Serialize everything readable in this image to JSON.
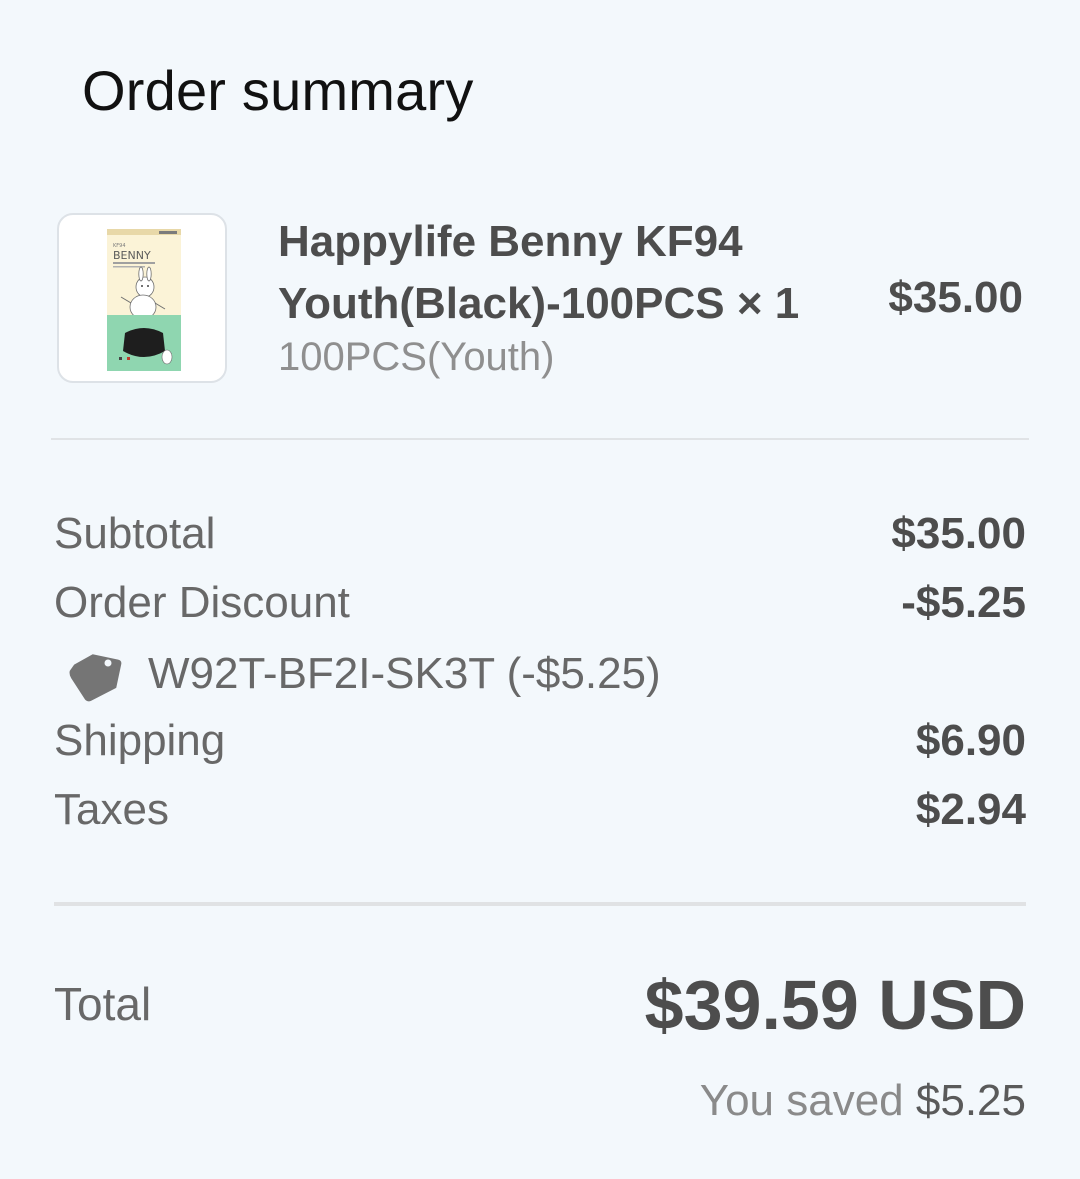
{
  "header": {
    "title": "Order summary"
  },
  "product": {
    "image_text": "BENNY",
    "name_line1": "Happylife Benny KF94",
    "name_line2": "Youth(Black)-100PCS × 1",
    "variant": "100PCS(Youth)",
    "price": "$35.00"
  },
  "summary": {
    "subtotal_label": "Subtotal",
    "subtotal_value": "$35.00",
    "discount_label": "Order Discount",
    "discount_value": "-$5.25",
    "discount_code": "W92T-BF2I-SK3T (-$5.25)",
    "shipping_label": "Shipping",
    "shipping_value": "$6.90",
    "taxes_label": "Taxes",
    "taxes_value": "$2.94"
  },
  "total": {
    "label": "Total",
    "value": "$39.59 USD",
    "saved_prefix": "You saved",
    "saved_amount": "$5.25"
  },
  "colors": {
    "background": "#f3f8fc",
    "text_dark": "#4d4d4d",
    "text_muted": "#8f8f8f",
    "divider": "#e0e3e6"
  },
  "icons": {
    "discount_tag": "tag-icon"
  }
}
